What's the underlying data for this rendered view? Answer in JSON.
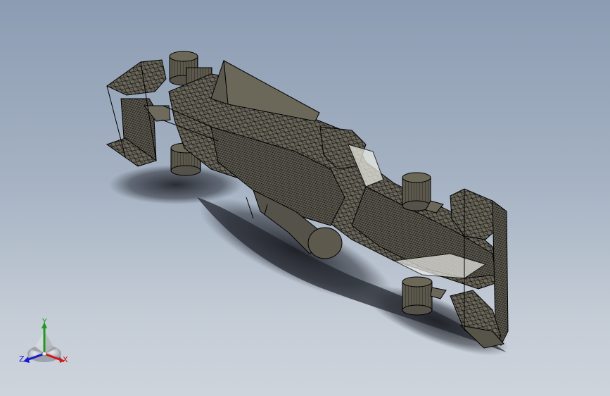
{
  "app": {
    "window": "solidworks-graphics-area"
  },
  "viewport": {
    "background_top": "#8c9cb2",
    "background_bottom": "#ced4dc",
    "model": {
      "type": "formula-1-car",
      "display_style": "wireframe-shaded",
      "edge_color": "#000000",
      "body_color": "#6b675a",
      "tire_color": "#5e5a4e"
    }
  },
  "triad": {
    "x_label": "X",
    "y_label": "Y",
    "z_label": "Z",
    "x_color": "#cc1a1a",
    "y_color": "#1f9a1f",
    "z_color": "#1a1acc"
  }
}
